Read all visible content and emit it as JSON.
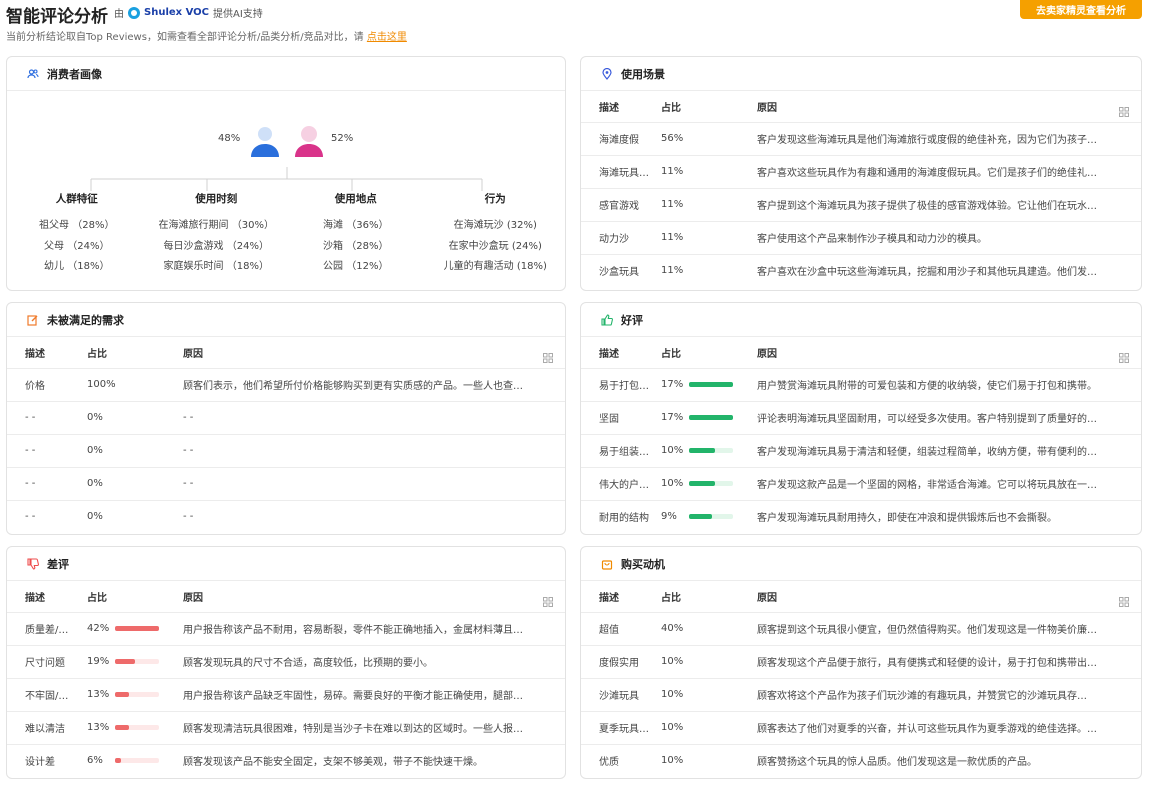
{
  "header": {
    "title": "智能评论分析",
    "by_prefix": "由",
    "brand": "Shulex VOC",
    "by_suffix": "提供AI支持",
    "subtitle": "当前分析结论取自Top Reviews，如需查看全部评论分析/品类分析/竞品对比，请",
    "subtitle_link": "点击这里",
    "cta_button": "去卖家精灵查看分析"
  },
  "consumer": {
    "title": "消费者画像",
    "male_pct": "48%",
    "female_pct": "52%",
    "columns": [
      {
        "heading": "人群特征",
        "rows": [
          "祖父母 （28%）",
          "父母 （24%）",
          "幼儿 （18%）"
        ]
      },
      {
        "heading": "使用时刻",
        "rows": [
          "在海滩旅行期间 （30%）",
          "每日沙盒游戏 （24%）",
          "家庭娱乐时间 （18%）"
        ]
      },
      {
        "heading": "使用地点",
        "rows": [
          "海滩 （36%）",
          "沙箱 （28%）",
          "公园 （12%）"
        ]
      },
      {
        "heading": "行为",
        "rows": [
          "在海滩玩沙 (32%)",
          "在家中沙盒玩 (24%)",
          "儿童的有趣活动 (18%)"
        ]
      }
    ]
  },
  "table_headers": {
    "desc": "描述",
    "share": "占比",
    "reason": "原因"
  },
  "scenes": {
    "title": "使用场景",
    "rows": [
      {
        "desc": "海滩度假",
        "share": "56%",
        "reason": "客户发现这些海滩玩具是他们海滩旅行或度假的绝佳补充，因为它们为孩子…"
      },
      {
        "desc": "海滩玩具…",
        "share": "11%",
        "reason": "客户喜欢这些玩具作为有趣和通用的海滩度假玩具。它们是孩子们的绝佳礼…"
      },
      {
        "desc": "感官游戏",
        "share": "11%",
        "reason": "客户提到这个海滩玩具为孩子提供了极佳的感官游戏体验。它让他们在玩水…"
      },
      {
        "desc": "动力沙",
        "share": "11%",
        "reason": "客户使用这个产品来制作沙子模具和动力沙的模具。"
      },
      {
        "desc": "沙盒玩具",
        "share": "11%",
        "reason": "客户喜欢在沙盒中玩这些海滩玩具，挖掘和用沙子和其他玩具建造。他们发…"
      }
    ]
  },
  "unmet": {
    "title": "未被满足的需求",
    "rows": [
      {
        "desc": "价格",
        "share": "100%",
        "reason": "顾客们表示，他们希望所付价格能够购买到更有实质感的产品。一些人也查…"
      },
      {
        "desc": "- -",
        "share": "0%",
        "reason": "- -"
      },
      {
        "desc": "- -",
        "share": "0%",
        "reason": "- -"
      },
      {
        "desc": "- -",
        "share": "0%",
        "reason": "- -"
      },
      {
        "desc": "- -",
        "share": "0%",
        "reason": "- -"
      }
    ]
  },
  "positive": {
    "title": "好评",
    "bar_color": "#22b46a",
    "rows": [
      {
        "desc": "易于打包…",
        "share": "17%",
        "level": 1.0,
        "reason": "用户赞赏海滩玩具附带的可爱包装和方便的收纳袋，使它们易于打包和携带。"
      },
      {
        "desc": "坚固",
        "share": "17%",
        "level": 1.0,
        "reason": "评论表明海滩玩具坚固耐用，可以经受多次使用。客户特别提到了质量好的…"
      },
      {
        "desc": "易于组装…",
        "share": "10%",
        "level": 0.59,
        "reason": "客户发现海滩玩具易于清洁和轻便，组装过程简单，收纳方便，带有便利的…"
      },
      {
        "desc": "伟大的户…",
        "share": "10%",
        "level": 0.59,
        "reason": "客户发现这款产品是一个坚固的网格，非常适合海滩。它可以将玩具放在一…"
      },
      {
        "desc": "耐用的结构",
        "share": "9%",
        "level": 0.53,
        "reason": "客户发现海滩玩具耐用持久，即使在冲浪和提供锻炼后也不会撕裂。"
      }
    ]
  },
  "negative": {
    "title": "差评",
    "bar_color": "#ee6a6a",
    "rows": [
      {
        "desc": "质量差/…",
        "share": "42%",
        "level": 1.0,
        "reason": "用户报告称该产品不耐用，容易断裂，零件不能正确地插入，金属材料薄且…"
      },
      {
        "desc": "尺寸问题",
        "share": "19%",
        "level": 0.45,
        "reason": "顾客发现玩具的尺寸不合适，高度较低，比预期的要小。"
      },
      {
        "desc": "不牢固/…",
        "share": "13%",
        "level": 0.31,
        "reason": "用户报告称该产品缺乏牢固性，易碎。需要良好的平衡才能正确使用，腿部…"
      },
      {
        "desc": "难以清洁",
        "share": "13%",
        "level": 0.31,
        "reason": "顾客发现清洁玩具很困难，特别是当沙子卡在难以到达的区域时。一些人报…"
      },
      {
        "desc": "设计差",
        "share": "6%",
        "level": 0.14,
        "reason": "顾客发现该产品不能安全固定，支架不够美观，带子不能快速干燥。"
      }
    ]
  },
  "motive": {
    "title": "购买动机",
    "rows": [
      {
        "desc": "超值",
        "share": "40%",
        "reason": "顾客提到这个玩具很小便宜，但仍然值得购买。他们发现这是一件物美价廉…"
      },
      {
        "desc": "度假实用",
        "share": "10%",
        "reason": "顾客发现这个产品便于旅行，具有便携式和轻便的设计，易于打包和携带出…"
      },
      {
        "desc": "沙滩玩具",
        "share": "10%",
        "reason": "顾客欢将这个产品作为孩子们玩沙滩的有趣玩具，并赞赏它的沙滩玩具存…"
      },
      {
        "desc": "夏季玩具…",
        "share": "10%",
        "reason": "顾客表达了他们对夏季的兴奋，并认可这些玩具作为夏季游戏的绝佳选择。…"
      },
      {
        "desc": "优质",
        "share": "10%",
        "reason": "顾客赞扬这个玩具的惊人品质。他们发现这是一款优质的产品。"
      }
    ]
  }
}
